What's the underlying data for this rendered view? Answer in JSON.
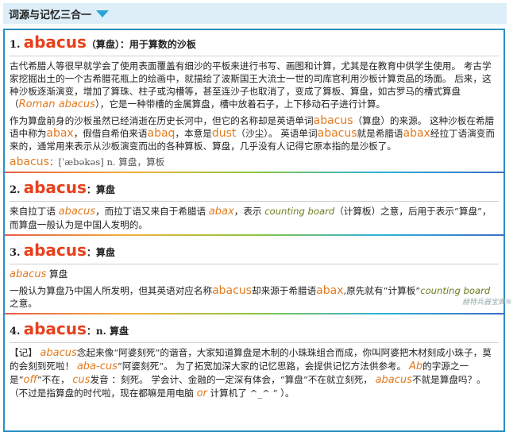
{
  "header": {
    "title": "词源与记忆三合一"
  },
  "watermark": "赫特兵器宝典®",
  "s1": {
    "num": "1.",
    "word": "abacus",
    "sub": "（算盘）：用于算数的沙板",
    "p1": "古代希腊人等很早就学会了使用表面覆盖有细沙的平板来进行书写、画图和计算，尤其是在教育中供学生使用。 考古学家挖掘出土的一个古希腊花瓶上的绘画中，就描绘了波斯国王大流士一世的司库官利用沙板计算贡品的场面。 后来，这种沙板逐渐演变，增加了算珠、柱子或沟槽等，甚至连沙子也取消了，变成了算板、算盘，如古罗马的槽式算盘（",
    "p1_en": "Roman abacus",
    "p1_tail": "），它是一种带槽的金属算盘，槽中放着石子，上下移动石子进行计算。",
    "p2_a": "作为算盘前身的沙板虽然已经消逝在历史长河中，但它的名称却是英语单词",
    "p2_en1": "abacus",
    "p2_b": "（算盘）的来源。 这种沙板在希腊语中称为",
    "p2_en2": "abax",
    "p2_c": "，假借自希伯来语",
    "p2_en3": "abaq",
    "p2_d": "，本意是",
    "p2_en4": "dust",
    "p2_e": "（沙尘）。 英语单词",
    "p2_en5": "abacus",
    "p2_f": "就是希腊语",
    "p2_en6": "abax",
    "p2_g": "经拉丁语演变而来的，通常用来表示从沙板演变而出的各种算板、算盘，几乎没有人记得它原本指的是沙板了。",
    "pron_word": "abacus",
    "pron": "：[ˈæbəkəs] n. 算盘，算板"
  },
  "s2": {
    "num": "2.",
    "word": "abacus",
    "sub": "：算盘",
    "a": "来自拉丁语 ",
    "en1": "abacus",
    "b": "，而拉丁语又来自于希腊语 ",
    "en2": "abax",
    "c": "，表示 ",
    "en3": "counting board",
    "d": "（计算板）之意，后用于表示“算盘”，而算盘一般认为是中国人发明的。"
  },
  "s3": {
    "num": "3.",
    "word": "abacus",
    "sub": "：算盘",
    "line1_en": "abacus",
    "line1": " 算盘",
    "a": "一般认为算盘乃中国人所发明，但其英语对应名称",
    "en1": "abacus",
    "b": "却来源于希腊语",
    "en2": "abax",
    "c": ",原先就有“计算板”",
    "en3": "counting board",
    "d": "之意。"
  },
  "s4": {
    "num": "4.",
    "word": "abacus",
    "sub": "：n. 算盘",
    "a": "【记】 ",
    "en1": "abacus",
    "b": "念起来像“阿婆刻死”的谐音，大家知道算盘是木制的小珠珠组合而成，你叫阿婆把木材刻成小珠子，莫的会刻到死啦！ ",
    "en2": "aba-cus",
    "c": "“阿婆刻死”。 为了拓宽加深大家的记忆思路，会提供记忆方法供参考。 ",
    "en3": "Ab",
    "d": "的字源之一是“",
    "en4": "off",
    "e": "”不在， ",
    "en5": "cus",
    "f": "发音 ：刻死。 学会计、金融的一定深有体会，“算盘”不在就立刻死， ",
    "en6": "abacus",
    "g": "不就是算盘吗？。（不过是指算盘的时代啦，现在都嘛是用电脑 ",
    "en7": "or",
    "h": " 计算机了 ^_^ “ ）。"
  }
}
